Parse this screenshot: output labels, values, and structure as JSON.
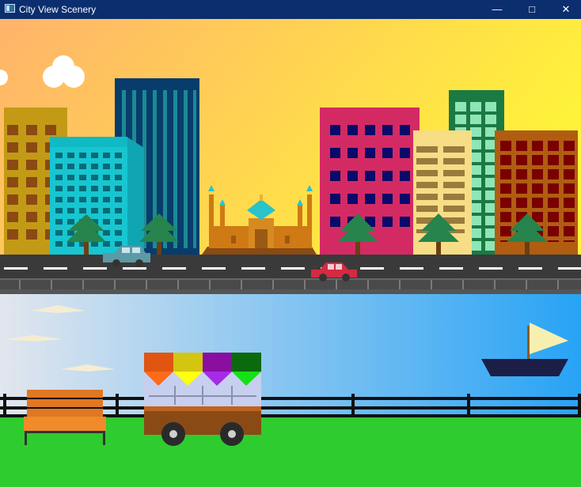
{
  "window": {
    "title": "City View Scenery",
    "icon": "app-window-icon",
    "controls": {
      "minimize": "—",
      "maximize": "□",
      "close": "✕"
    }
  },
  "colors": {
    "titlebar": "#0b2e6e",
    "sky_top_left": "#ffb36b",
    "sky_right": "#fff23a",
    "road": "#3a3a3a",
    "lower_sky_left": "#e2e6ee",
    "lower_sky_right": "#27a3f5",
    "grass": "#2ecc2e",
    "fence": "#111111"
  },
  "scene": {
    "upper": [
      "clouds",
      "skyscrapers",
      "mosque",
      "trees",
      "cars",
      "road"
    ],
    "lower": [
      "wispy-clouds",
      "sailboat",
      "bench",
      "vendor-cart",
      "fence",
      "grass"
    ]
  }
}
